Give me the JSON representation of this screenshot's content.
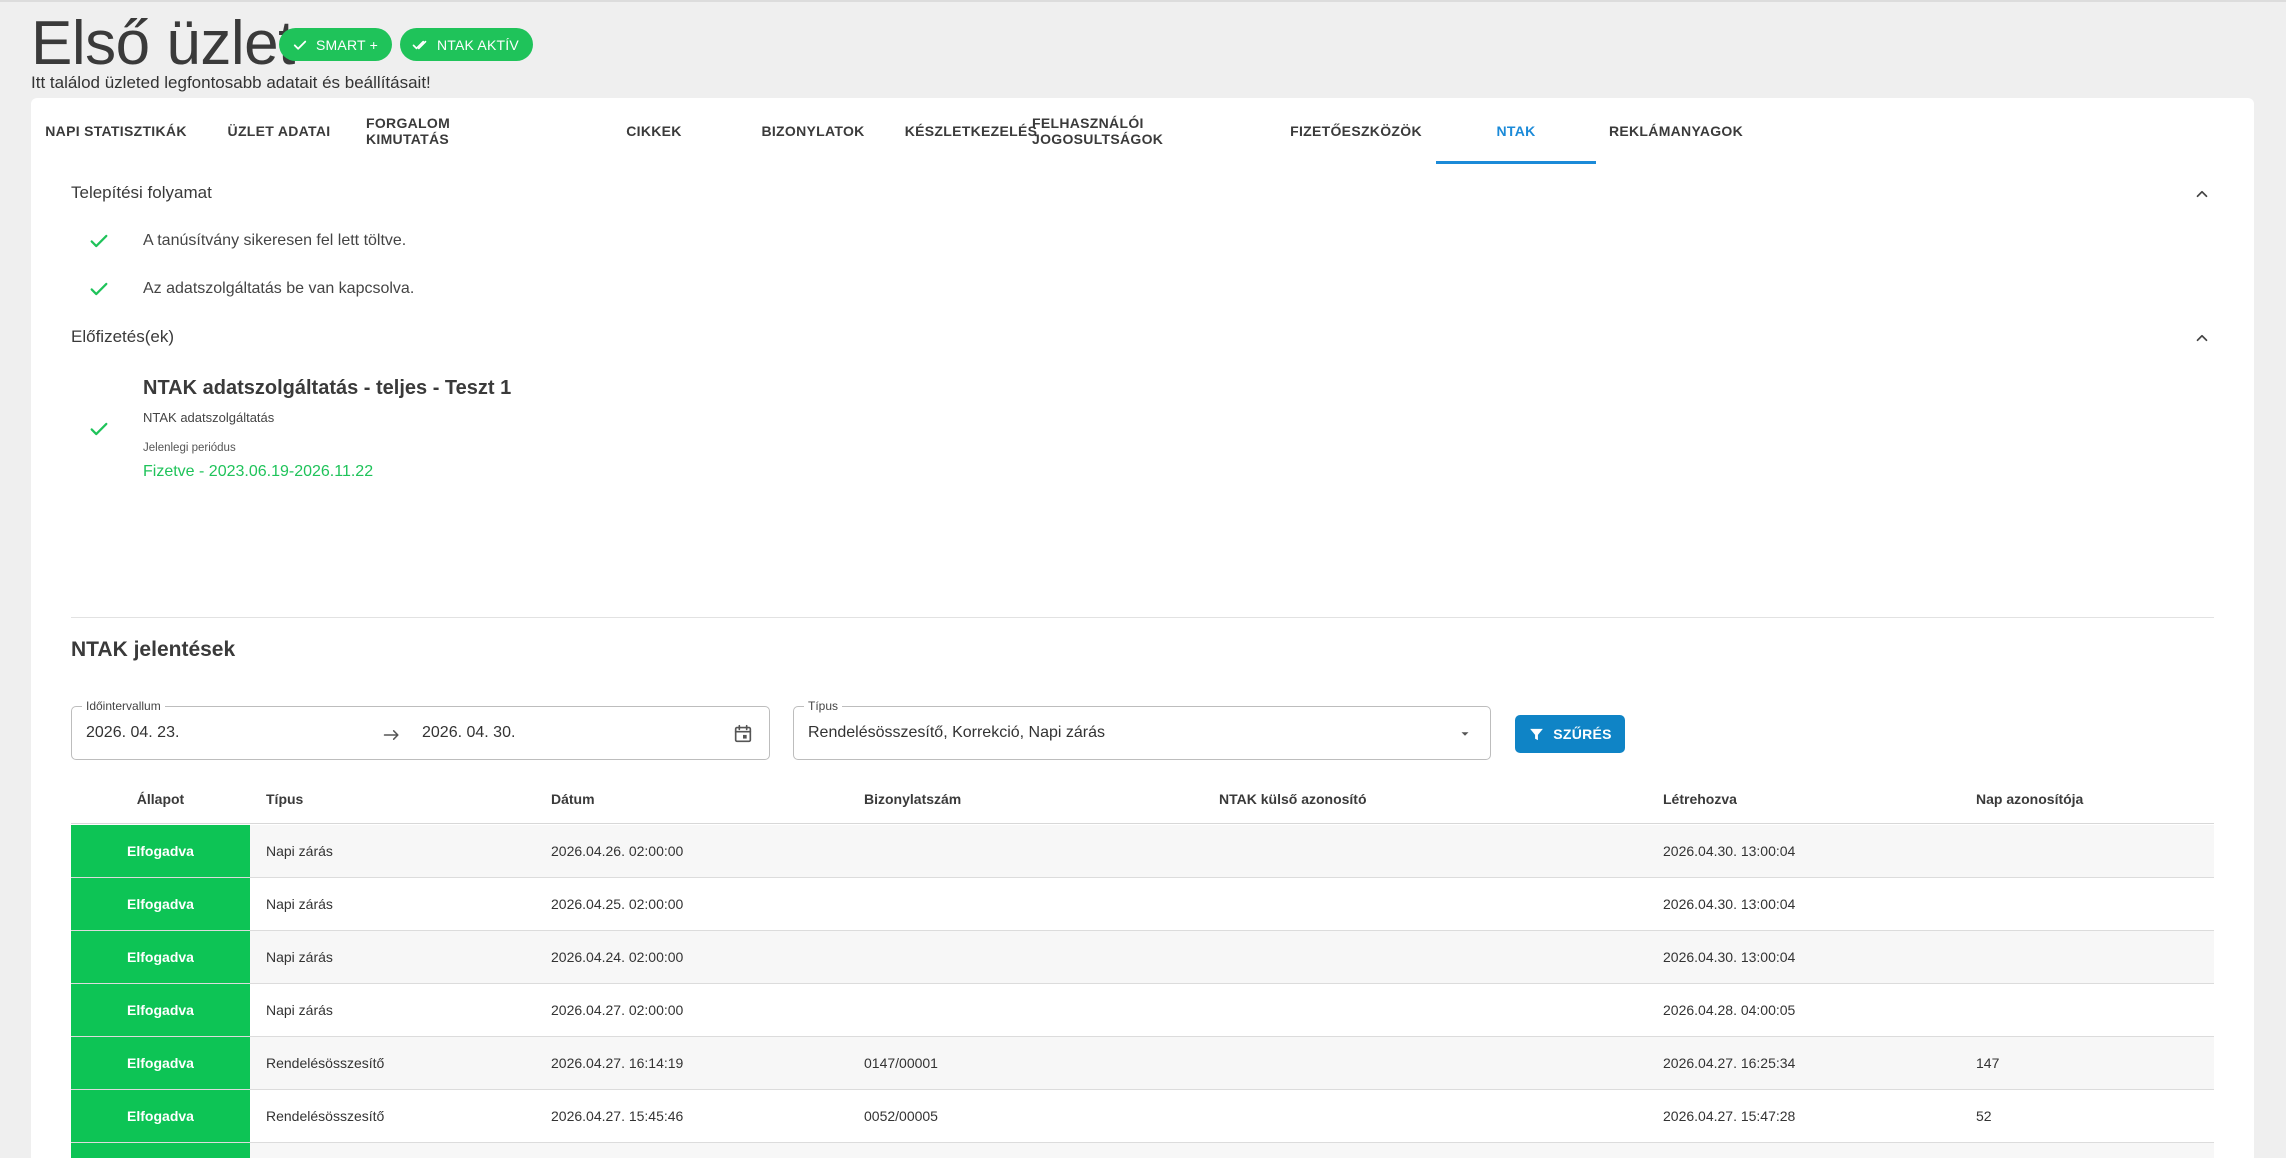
{
  "header": {
    "title": "Első üzlet",
    "badges": [
      "SMART +",
      "NTAK AKTÍV"
    ],
    "subtitle": "Itt találod üzleted legfontosabb adatait és beállításait!"
  },
  "tabs": [
    {
      "label": "NAPI STATISZTIKÁK",
      "active": false
    },
    {
      "label": "ÜZLET ADATAI",
      "active": false
    },
    {
      "label": "FORGALOM KIMUTATÁS",
      "active": false
    },
    {
      "label": "CIKKEK",
      "active": false
    },
    {
      "label": "BIZONYLATOK",
      "active": false
    },
    {
      "label": "KÉSZLETKEZELÉS",
      "active": false
    },
    {
      "label": "FELHASZNÁLÓI JOGOSULTSÁGOK",
      "active": false
    },
    {
      "label": "FIZETŐESZKÖZÖK",
      "active": false
    },
    {
      "label": "NTAK",
      "active": true
    },
    {
      "label": "REKLÁMANYAGOK",
      "active": false
    }
  ],
  "install": {
    "heading": "Telepítési folyamat",
    "steps": [
      "A tanúsítvány sikeresen fel lett töltve.",
      "Az adatszolgáltatás be van kapcsolva."
    ]
  },
  "subscriptions": {
    "heading": "Előfizetés(ek)",
    "title": "NTAK adatszolgáltatás - teljes - Teszt 1",
    "description": "NTAK adatszolgáltatás",
    "period_label": "Jelenlegi periódus",
    "period": "Fizetve - 2023.06.19-2026.11.22"
  },
  "reports": {
    "title": "NTAK jelentések",
    "interval_label": "Időintervallum",
    "date_from": "2026. 04. 23.",
    "date_to": "2026. 04. 30.",
    "type_label": "Típus",
    "type_value": "Rendelésösszesítő, Korrekció, Napi zárás",
    "filter_button": "SZŰRÉS",
    "columns": [
      "Állapot",
      "Típus",
      "Dátum",
      "Bizonylatszám",
      "NTAK külső azonosító",
      "Létrehozva",
      "Nap azonosítója"
    ],
    "rows": [
      {
        "status": "Elfogadva",
        "type": "Napi zárás",
        "date": "2026.04.26. 02:00:00",
        "doc": "",
        "ext": "",
        "created": "2026.04.30. 13:00:04",
        "day": ""
      },
      {
        "status": "Elfogadva",
        "type": "Napi zárás",
        "date": "2026.04.25. 02:00:00",
        "doc": "",
        "ext": "",
        "created": "2026.04.30. 13:00:04",
        "day": ""
      },
      {
        "status": "Elfogadva",
        "type": "Napi zárás",
        "date": "2026.04.24. 02:00:00",
        "doc": "",
        "ext": "",
        "created": "2026.04.30. 13:00:04",
        "day": ""
      },
      {
        "status": "Elfogadva",
        "type": "Napi zárás",
        "date": "2026.04.27. 02:00:00",
        "doc": "",
        "ext": "",
        "created": "2026.04.28. 04:00:05",
        "day": ""
      },
      {
        "status": "Elfogadva",
        "type": "Rendelésösszesítő",
        "date": "2026.04.27. 16:14:19",
        "doc": "0147/00001",
        "ext": "",
        "created": "2026.04.27. 16:25:34",
        "day": "147"
      },
      {
        "status": "Elfogadva",
        "type": "Rendelésösszesítő",
        "date": "2026.04.27. 15:45:46",
        "doc": "0052/00005",
        "ext": "",
        "created": "2026.04.27. 15:47:28",
        "day": "52"
      },
      {
        "status": "",
        "type": "",
        "date": "",
        "doc": "",
        "ext": "",
        "created": "",
        "day": ""
      }
    ]
  },
  "colors": {
    "accent": "#1b8ad8",
    "success": "#1fc35a",
    "status_bg": "#0dc455",
    "button": "#0f84c6"
  }
}
